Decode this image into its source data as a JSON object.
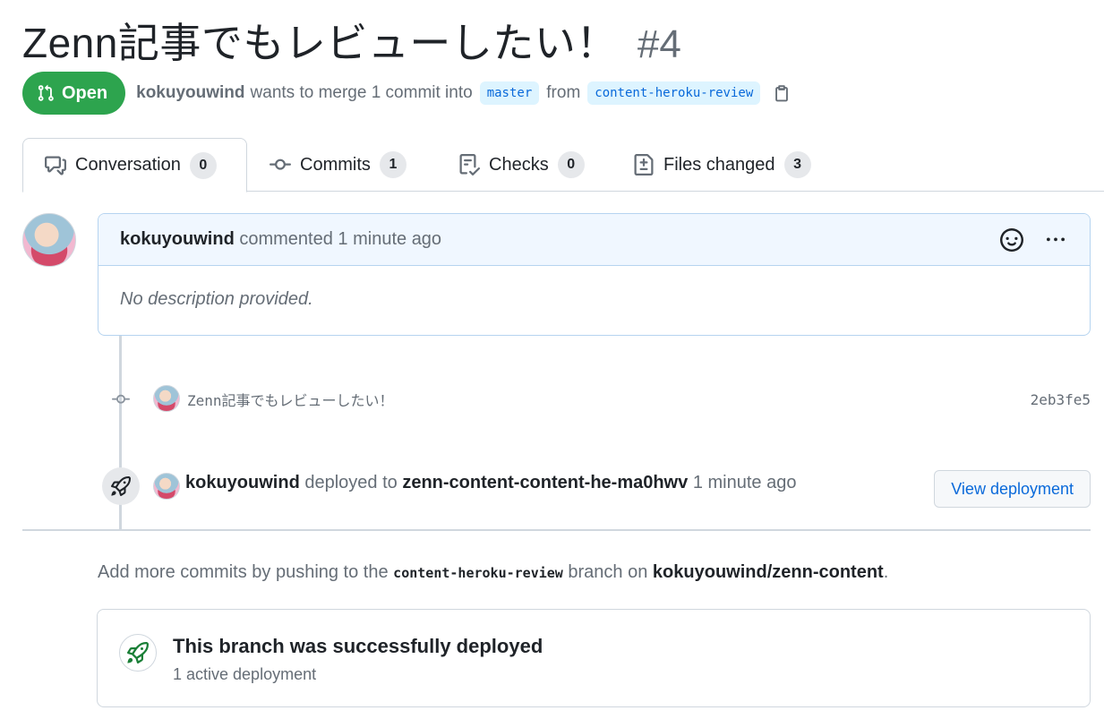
{
  "pr": {
    "title": "Zenn記事でもレビューしたい！",
    "number": "#4",
    "state": "Open",
    "author": "kokuyouwind",
    "merge_text": "wants to merge 1 commit into",
    "base_branch": "master",
    "from_text": "from",
    "head_branch": "content-heroku-review"
  },
  "tabs": [
    {
      "label": "Conversation",
      "count": "0",
      "icon": "comment-discussion-icon"
    },
    {
      "label": "Commits",
      "count": "1",
      "icon": "git-commit-icon"
    },
    {
      "label": "Checks",
      "count": "0",
      "icon": "checklist-icon"
    },
    {
      "label": "Files changed",
      "count": "3",
      "icon": "file-diff-icon"
    }
  ],
  "comment": {
    "author": "kokuyouwind",
    "action": "commented",
    "time": "1 minute ago",
    "body": "No description provided."
  },
  "commit": {
    "message": "Zenn記事でもレビューしたい！",
    "sha": "2eb3fe5"
  },
  "deploy_event": {
    "author": "kokuyouwind",
    "action": "deployed to",
    "environment": "zenn-content-content-he-ma0hwv",
    "time": "1 minute ago",
    "button": "View deployment"
  },
  "hint": {
    "prefix": "Add more commits by pushing to the",
    "branch": "content-heroku-review",
    "middle": "branch on",
    "repo": "kokuyouwind/zenn-content",
    "suffix": "."
  },
  "deploy_status": {
    "title": "This branch was successfully deployed",
    "subtitle": "1 active deployment"
  },
  "colors": {
    "open_green": "#2da44e",
    "link_blue": "#0969da",
    "muted": "#656d76",
    "comment_header_bg": "#f0f7ff"
  }
}
